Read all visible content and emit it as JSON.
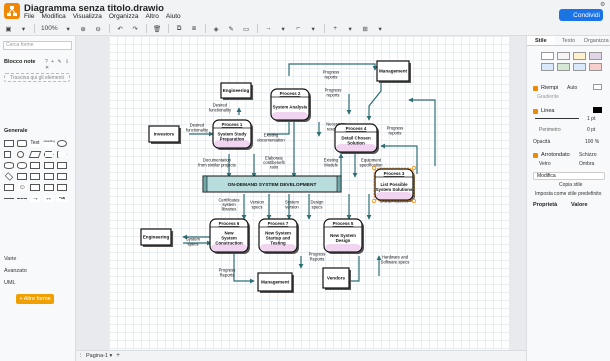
{
  "app": {
    "title": "Diagramma senza titolo.drawio",
    "menu": [
      "File",
      "Modifica",
      "Visualizza",
      "Organizza",
      "Altro",
      "Aiuto"
    ],
    "share_label": "Condividi",
    "accent": "#f08705",
    "share_color": "#1a73e8"
  },
  "toolbar": {
    "zoom": "100%"
  },
  "left_panel": {
    "search_placeholder": "Cerca forme",
    "notes_title": "Blocco note",
    "drag_hint": "Trascina qui gli elementi",
    "general_title": "Generale",
    "sections": [
      "Varie",
      "Avanzato",
      "UML"
    ],
    "more_shapes": "+ Altre forme"
  },
  "bottom": {
    "page_tab": "Pagina-1"
  },
  "right_panel": {
    "tabs": [
      "Stile",
      "Testo",
      "Organizza"
    ],
    "fill_label": "Riempi",
    "fill_mode": "Auto",
    "gradient_label": "Gradiente",
    "line_label": "Linea",
    "line_width": "1 pt",
    "perimeter_label": "Perimetro",
    "perimeter_value": "0 pt",
    "opacity_label": "Opacità",
    "opacity_value": "100 %",
    "rounded_label": "Arrotondato",
    "sketch_label": "Schizzo",
    "glass_label": "Vetro",
    "shadow_label": "Ombra",
    "edit_label": "Modifica",
    "copy_style": "Copia stile",
    "set_default": "Imposta come stile predefinito",
    "property_label": "Proprietà",
    "value_label": "Valore"
  },
  "diagram": {
    "nodes": {
      "engineering_top": "Engineering",
      "management_top": "Management",
      "investors": "Investors",
      "p1_title": "Process 1",
      "p1_body": "System Study\nPreparation",
      "p2_title": "Process 2",
      "p2_body": "System Analysis",
      "p4_title": "Process 4",
      "p4_body": "Detail Chosen\nSolution",
      "p3_title": "Process 3",
      "p3_body": "List Possible\nSystem Solutions",
      "bar": "ON-DEMAND SYSTEM DEVELOPMENT",
      "engineering_bottom": "Engineering",
      "p6_title": "Process 6",
      "p6_body": "New\nSystem\nConstruction",
      "p7_title": "Process 7",
      "p7_body": "New System\nStartup and\nTesting",
      "p5_title": "Process 5",
      "p5_body": "New System\nDesign",
      "management_bottom": "Management",
      "vendors": "Vendors"
    },
    "edge_labels": {
      "desired_functionality_1": "Desired\nfunctionality",
      "desired_functionality_2": "Desired\nfunctionality",
      "progress_reports_1": "Progress\nreports",
      "progress_reports_2": "Progress\nreports",
      "progress_reports_3": "Progress\nreports",
      "existing_documentation": "Existing\ndocumentation",
      "necessary_resources": "Necessary\nresources",
      "documentation_similar": "Documentation\nfrom similar projects",
      "elaborate_cost": "Elaborate\ncost/benefit\nratio",
      "existing_models": "Existing\nModels",
      "equipment_spec": "Equipment\nspecification",
      "resources": "Resources",
      "system_advantages": "System\nAdvantages\nand Limitations",
      "certificates": "Certificates\nsystem\nlibraries",
      "version_specs": "Version\nspecs",
      "system_version": "System\nversion",
      "design_specs": "Design\nspecs",
      "system_specs_1": "System\nspecs",
      "system_specs_2": "System\nspecs",
      "progress_reports_4": "Progress\nReports",
      "progress_reports_5": "Progress\nReports",
      "hardware_software": "Hardware and\nSoftware specs"
    }
  }
}
